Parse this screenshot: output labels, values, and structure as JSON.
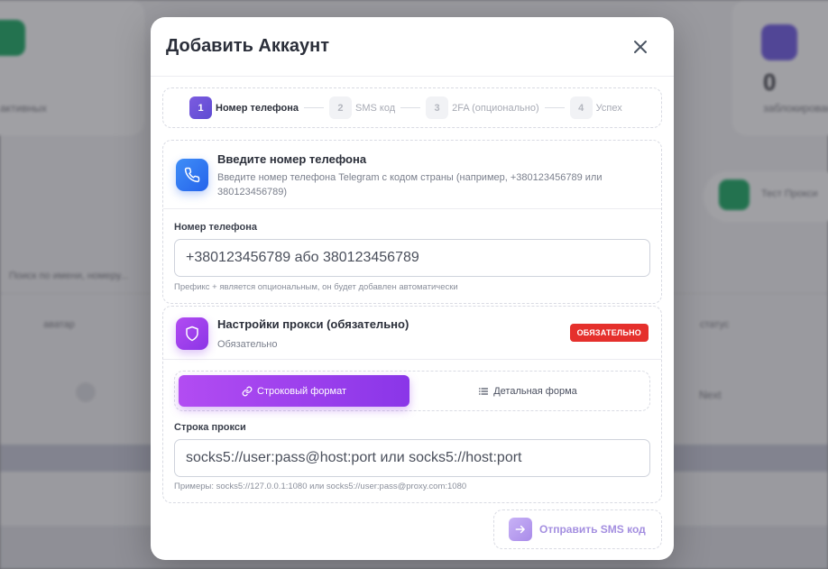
{
  "background": {
    "stat_left_label": "активных",
    "stat_right_value": "0",
    "stat_right_label": "заблокировано",
    "proxy_test_label": "Тест Прокси",
    "search_placeholder": "Поиск по имени, номеру...",
    "col_avatar": "аватар",
    "col_status": "статус",
    "next_label": "Next"
  },
  "modal": {
    "title": "Добавить Аккаунт",
    "close_icon": "close-icon"
  },
  "stepper": {
    "steps": [
      {
        "num": "1",
        "label": "Номер телефона",
        "active": true
      },
      {
        "num": "2",
        "label": "SMS код",
        "active": false
      },
      {
        "num": "3",
        "label": "2FA (опционально)",
        "active": false
      },
      {
        "num": "4",
        "label": "Успех",
        "active": false
      }
    ]
  },
  "phone_section": {
    "icon": "phone-icon",
    "title": "Введите номер телефона",
    "subtitle": "Введите номер телефона Telegram с кодом страны (например, +380123456789 или 380123456789)",
    "field_label": "Номер телефона",
    "placeholder": "+380123456789 або 380123456789",
    "value": "",
    "hint": "Префикс + является опциональным, он будет добавлен автоматически"
  },
  "proxy_section": {
    "icon": "shield-icon",
    "title": "Настройки прокси (обязательно)",
    "subtitle": "Обязательно",
    "badge": "ОБЯЗАТЕЛЬНО",
    "format_string_label": "Строковый формат",
    "format_detailed_label": "Детальная форма",
    "field_label": "Строка прокси",
    "placeholder": "socks5://user:pass@host:port или socks5://host:port",
    "value": "",
    "hint": "Примеры: socks5://127.0.0.1:1080 или socks5://user:pass@proxy.com:1080"
  },
  "footer": {
    "send_label": "Отправить SMS код",
    "send_icon": "arrow-right-icon"
  },
  "colors": {
    "accent_purple": "#8a36e8",
    "accent_blue": "#2563eb",
    "danger": "#e5302c"
  }
}
